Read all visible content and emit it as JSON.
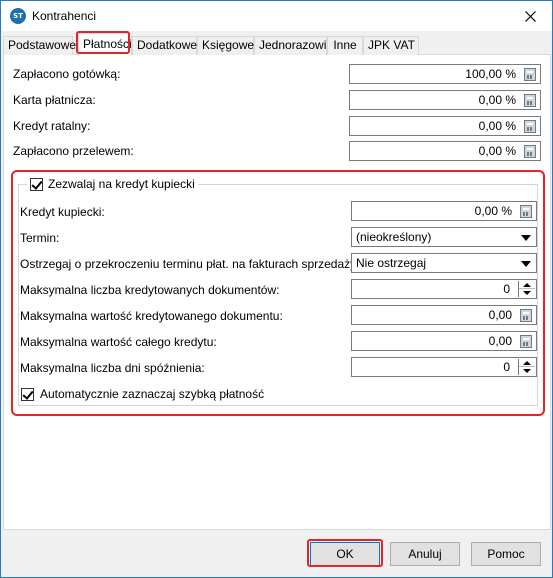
{
  "window": {
    "title": "Kontrahenci",
    "icon": "app-logo-icon",
    "close_icon": "close-icon"
  },
  "tabs": [
    {
      "label": "Podstawowe",
      "active": false
    },
    {
      "label": "Płatności",
      "active": true
    },
    {
      "label": "Dodatkowe",
      "active": false
    },
    {
      "label": "Księgowe",
      "active": false
    },
    {
      "label": "Jednorazowi",
      "active": false
    },
    {
      "label": "Inne",
      "active": false
    },
    {
      "label": "JPK VAT",
      "active": false
    }
  ],
  "payments": {
    "cash": {
      "label": "Zapłacono gotówką:",
      "value": "100,00 %"
    },
    "card": {
      "label": "Karta płatnicza:",
      "value": "0,00 %"
    },
    "installment": {
      "label": "Kredyt ratalny:",
      "value": "0,00 %"
    },
    "transfer": {
      "label": "Zapłacono przelewem:",
      "value": "0,00 %"
    }
  },
  "merchant_credit": {
    "allow_label": "Zezwalaj na kredyt kupiecki",
    "allow_checked": true,
    "credit": {
      "label": "Kredyt kupiecki:",
      "value": "0,00 %"
    },
    "term": {
      "label": "Termin:",
      "value": "(nieokreślony)"
    },
    "warn": {
      "label": "Ostrzegaj o przekroczeniu terminu płat. na fakturach sprzedaży:",
      "value": "Nie ostrzegaj"
    },
    "max_docs": {
      "label": "Maksymalna liczba kredytowanych dokumentów:",
      "value": "0"
    },
    "max_doc_value": {
      "label": "Maksymalna wartość kredytowanego dokumentu:",
      "value": "0,00"
    },
    "max_total": {
      "label": "Maksymalna wartość całego kredytu:",
      "value": "0,00"
    },
    "max_days": {
      "label": "Maksymalna liczba dni spóźnienia:",
      "value": "0"
    },
    "auto_fast_label": "Automatycznie zaznaczaj szybką płatność",
    "auto_fast_checked": true
  },
  "buttons": {
    "ok": "OK",
    "cancel": "Anuluj",
    "help": "Pomoc"
  },
  "colors": {
    "highlight": "#e0262b",
    "window_border": "#2a7ab8"
  }
}
